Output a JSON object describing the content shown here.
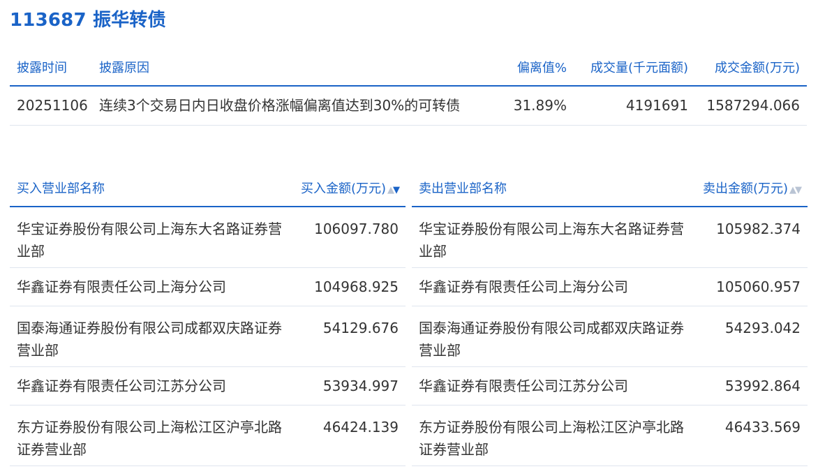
{
  "page_title": "113687 振华转债",
  "disclosure": {
    "headers": [
      "披露时间",
      "披露原因",
      "偏离值%",
      "成交量(千元面额)",
      "成交金额(万元)"
    ],
    "row": {
      "date": "20251106",
      "reason": "连续3个交易日内日收盘价格涨幅偏离值达到30%的可转债",
      "deviation": "31.89%",
      "volume": "4191691",
      "amount": "1587294.066"
    }
  },
  "buy": {
    "name_header": "买入营业部名称",
    "amount_header": "买入金额(万元)",
    "rows": [
      {
        "name": "华宝证券股份有限公司上海东大名路证券营业部",
        "amount": "106097.780"
      },
      {
        "name": "华鑫证券有限责任公司上海分公司",
        "amount": "104968.925"
      },
      {
        "name": "国泰海通证券股份有限公司成都双庆路证券营业部",
        "amount": "54129.676"
      },
      {
        "name": "华鑫证券有限责任公司江苏分公司",
        "amount": "53934.997"
      },
      {
        "name": "东方证券股份有限公司上海松江区沪亭北路证券营业部",
        "amount": "46424.139"
      }
    ]
  },
  "sell": {
    "name_header": "卖出营业部名称",
    "amount_header": "卖出金额(万元)",
    "rows": [
      {
        "name": "华宝证券股份有限公司上海东大名路证券营业部",
        "amount": "105982.374"
      },
      {
        "name": "华鑫证券有限责任公司上海分公司",
        "amount": "105060.957"
      },
      {
        "name": "国泰海通证券股份有限公司成都双庆路证券营业部",
        "amount": "54293.042"
      },
      {
        "name": "华鑫证券有限责任公司江苏分公司",
        "amount": "53992.864"
      },
      {
        "name": "东方证券股份有限公司上海松江区沪亭北路证券营业部",
        "amount": "46433.569"
      }
    ]
  },
  "sort_icons": {
    "up": "▲",
    "down": "▼"
  },
  "colors": {
    "accent": "#1a63c7",
    "row_divider": "#dfe5ee",
    "text": "#333333"
  }
}
